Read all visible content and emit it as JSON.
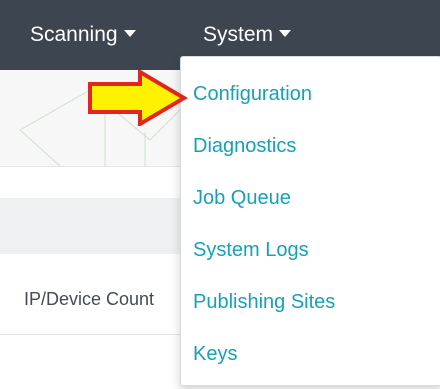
{
  "navbar": {
    "items": [
      {
        "label": "Scanning"
      },
      {
        "label": "System"
      }
    ]
  },
  "background": {
    "row_label": "IP/Device Count"
  },
  "dropdown": {
    "items": [
      {
        "label": "Configuration"
      },
      {
        "label": "Diagnostics"
      },
      {
        "label": "Job Queue"
      },
      {
        "label": "System Logs"
      },
      {
        "label": "Publishing Sites"
      },
      {
        "label": "Keys"
      }
    ]
  },
  "colors": {
    "navbar_bg": "#3d4650",
    "menu_link": "#17a1b7",
    "arrow_fill": "#fff200",
    "arrow_outline": "#e0261d"
  },
  "annotation": {
    "icon": "pointer-arrow-icon",
    "target": "Configuration"
  }
}
